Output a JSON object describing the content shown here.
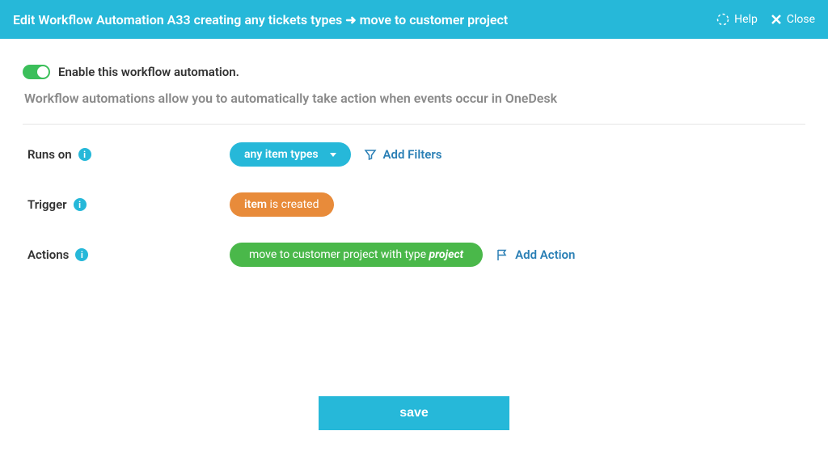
{
  "header": {
    "title": "Edit Workflow Automation A33 creating any tickets types ➜ move to customer project",
    "help_label": "Help",
    "close_label": "Close"
  },
  "toggle": {
    "label": "Enable this workflow automation."
  },
  "description": "Workflow automations allow you to automatically take action when events occur in OneDesk",
  "rows": {
    "runs_on": {
      "label": "Runs on",
      "pill_label": "any item types",
      "add_label": "Add Filters"
    },
    "trigger": {
      "label": "Trigger",
      "pill_strong": "item",
      "pill_rest": " is created"
    },
    "actions": {
      "label": "Actions",
      "pill_main": "move to customer project with type ",
      "pill_em": "project",
      "add_label": "Add Action"
    }
  },
  "save_label": "save"
}
